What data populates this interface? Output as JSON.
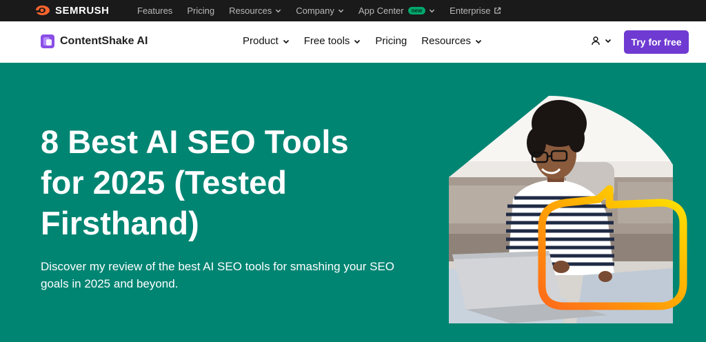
{
  "topbar": {
    "logo_text": "SEMRUSH",
    "nav": [
      {
        "label": "Features",
        "has_dropdown": false
      },
      {
        "label": "Pricing",
        "has_dropdown": false
      },
      {
        "label": "Resources",
        "has_dropdown": true
      },
      {
        "label": "Company",
        "has_dropdown": true
      },
      {
        "label": "App Center",
        "has_dropdown": true,
        "badge": "new"
      },
      {
        "label": "Enterprise",
        "icon": "external-link-icon"
      }
    ]
  },
  "header": {
    "brand": "ContentShake AI",
    "menu": [
      {
        "label": "Product",
        "has_dropdown": true
      },
      {
        "label": "Free tools",
        "has_dropdown": true
      },
      {
        "label": "Pricing",
        "has_dropdown": false
      },
      {
        "label": "Resources",
        "has_dropdown": true
      }
    ],
    "account_icon": "user-icon",
    "cta_label": "Try for free"
  },
  "hero": {
    "title_lines": [
      "8 Best AI SEO Tools",
      "for 2025 (Tested",
      "Firsthand)"
    ],
    "subtitle_lines": [
      "Discover my review of the best AI SEO tools for smashing your SEO",
      "goals in 2025 and beyond."
    ]
  },
  "colors": {
    "topbar_bg": "#1a1a1a",
    "hero_bg": "#008573",
    "cta_bg": "#6e3ad1",
    "semrush_orange": "#ff642d",
    "new_badge": "#00a86b",
    "bubble_gradient_start": "#ff6a1a",
    "bubble_gradient_end": "#ffe600"
  }
}
